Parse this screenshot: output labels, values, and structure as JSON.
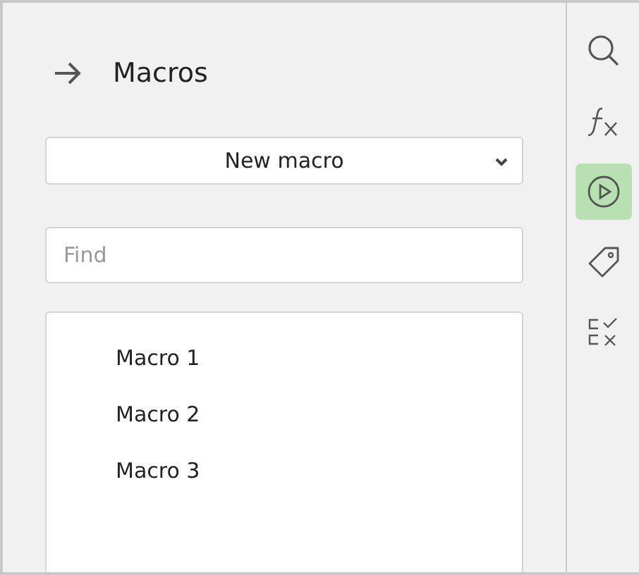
{
  "panel": {
    "title": "Macros"
  },
  "dropdown": {
    "value": "New macro"
  },
  "search": {
    "placeholder": "Find"
  },
  "macros": [
    {
      "label": "Macro 1"
    },
    {
      "label": "Macro 2"
    },
    {
      "label": "Macro 3"
    }
  ],
  "sidebar": [
    {
      "kind": "search",
      "selected": false
    },
    {
      "kind": "function",
      "selected": false
    },
    {
      "kind": "play",
      "selected": true
    },
    {
      "kind": "tag",
      "selected": false
    },
    {
      "kind": "checklist",
      "selected": false
    }
  ]
}
